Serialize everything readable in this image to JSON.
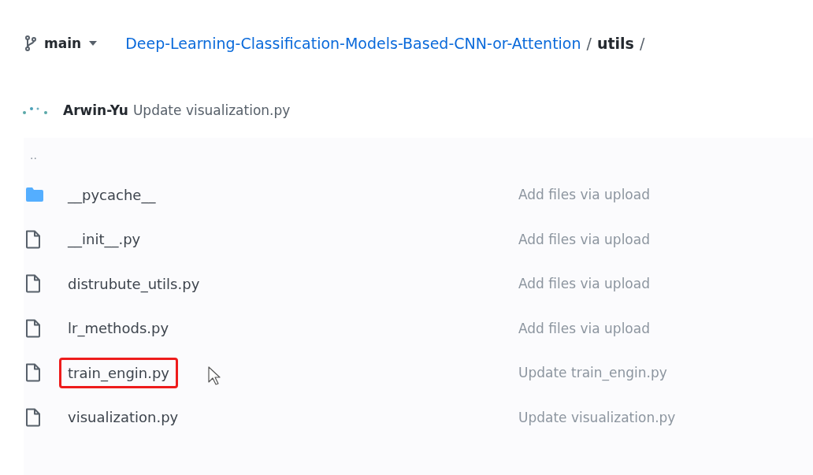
{
  "branch": {
    "name": "main"
  },
  "breadcrumb": {
    "repo": "Deep-Learning-Classification-Models-Based-CNN-or-Attention",
    "separator_1": "/",
    "folder": "utils",
    "separator_2": "/"
  },
  "latest_commit": {
    "author": "Arwin-Yu",
    "message": "Update visualization.py"
  },
  "parent_row": {
    "label": ".."
  },
  "files": [
    {
      "kind": "folder",
      "name": "__pycache__",
      "message": "Add files via upload",
      "highlighted": false
    },
    {
      "kind": "file",
      "name": "__init__.py",
      "message": "Add files via upload",
      "highlighted": false
    },
    {
      "kind": "file",
      "name": "distrubute_utils.py",
      "message": "Add files via upload",
      "highlighted": false
    },
    {
      "kind": "file",
      "name": "lr_methods.py",
      "message": "Add files via upload",
      "highlighted": false
    },
    {
      "kind": "file",
      "name": "train_engin.py",
      "message": "Update train_engin.py",
      "highlighted": true
    },
    {
      "kind": "file",
      "name": "visualization.py",
      "message": "Update visualization.py",
      "highlighted": false
    }
  ]
}
